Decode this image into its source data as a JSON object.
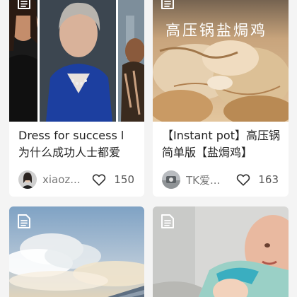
{
  "feed": {
    "cards": [
      {
        "title": "Dress for success l 为什么成功人士都爱",
        "author": "xiaoz...",
        "likes": "150"
      },
      {
        "title": "【Instant pot】高压锅简单版【盐焗鸡】",
        "author": "TK爱...",
        "likes": "163",
        "image_text": "高压锅盐焗鸡"
      },
      {
        "title": "",
        "author": "",
        "likes": ""
      },
      {
        "title": "",
        "author": "",
        "likes": ""
      }
    ]
  },
  "icons": {
    "note": "note-icon",
    "like": "heart-icon",
    "avatar": "avatar"
  }
}
